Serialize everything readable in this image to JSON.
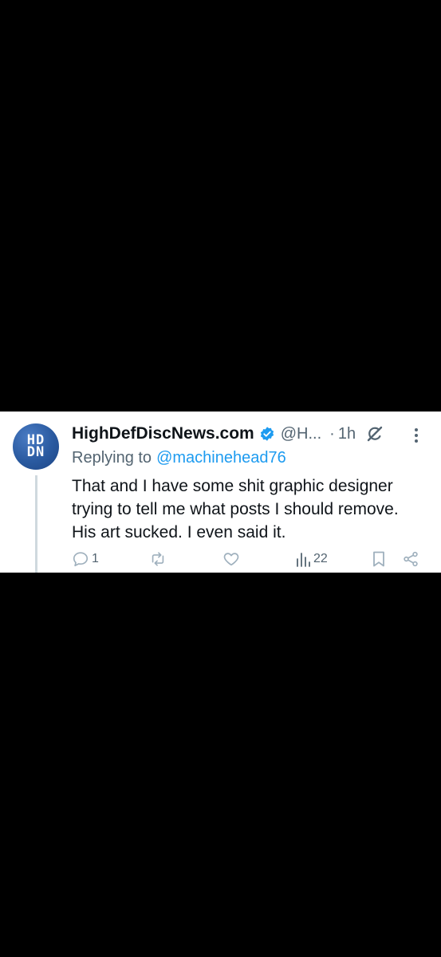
{
  "post": {
    "avatar_text": "HD\nDN",
    "display_name": "HighDefDiscNews.com",
    "handle": "@H...",
    "separator": "·",
    "time": "1h",
    "replying_prefix": "Replying to",
    "replying_to": "@machinehead76",
    "text": "That and I have some shit graphic designer\ntrying to tell me what posts I should remove.\nHis art sucked. I even said it.",
    "icons": {
      "verified": "verified-badge-icon",
      "grok": "grok-icon",
      "more": "more-options-icon"
    }
  },
  "actions": {
    "reply": {
      "icon": "reply-icon",
      "count": "1"
    },
    "repost": {
      "icon": "repost-icon",
      "count": ""
    },
    "like": {
      "icon": "like-icon",
      "count": ""
    },
    "views": {
      "icon": "views-icon",
      "count": "22"
    },
    "bookmark": {
      "icon": "bookmark-icon"
    },
    "share": {
      "icon": "share-icon"
    }
  },
  "colors": {
    "background": "#000000",
    "card": "#ffffff",
    "text": "#0f1419",
    "secondary": "#536471",
    "link": "#1d9bf0",
    "icon_muted": "#9fb0bd"
  }
}
